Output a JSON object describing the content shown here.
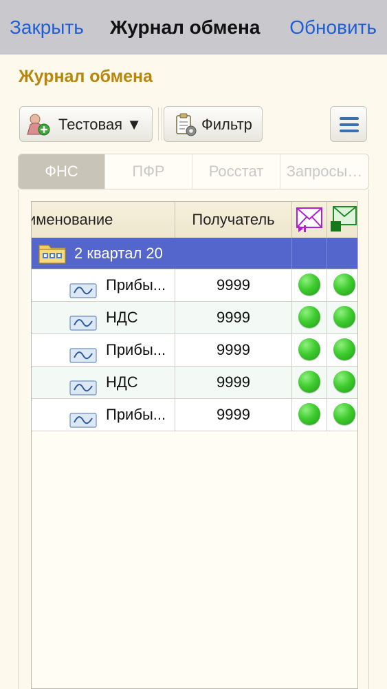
{
  "nav": {
    "close_label": "Закрыть",
    "title": "Журнал обмена",
    "refresh_label": "Обновить"
  },
  "form": {
    "title": "Журнал обмена"
  },
  "toolbar": {
    "mode_label": "Тестовая ▼",
    "filter_label": "Фильтр"
  },
  "tabs": [
    {
      "label": "ФНС",
      "active": true
    },
    {
      "label": "ПФР",
      "active": false
    },
    {
      "label": "Росстат",
      "active": false
    },
    {
      "label": "Запросы…",
      "active": false
    }
  ],
  "table": {
    "columns": {
      "name": "именование",
      "recipient": "Получатель"
    },
    "group": {
      "label": "2 квартал 20"
    },
    "rows": [
      {
        "name": "Прибы...",
        "recipient": "9999",
        "status1": "green",
        "status2": "green"
      },
      {
        "name": "НДС",
        "recipient": "9999",
        "status1": "green",
        "status2": "green"
      },
      {
        "name": "Прибы...",
        "recipient": "9999",
        "status1": "green",
        "status2": "green"
      },
      {
        "name": "НДС",
        "recipient": "9999",
        "status1": "green",
        "status2": "green"
      },
      {
        "name": "Прибы...",
        "recipient": "9999",
        "status1": "green",
        "status2": "green"
      }
    ]
  },
  "colors": {
    "accent": "#1f5fd6",
    "title": "#b8860b",
    "group_row": "#5466cb",
    "status_ok": "#3fcc2f"
  },
  "icons": {
    "mode_button": "users-add-icon",
    "filter_button": "clipboard-gear-icon",
    "menu_button": "hamburger-menu-icon",
    "column_sent": "envelope-outgoing-icon",
    "column_received": "envelope-received-icon",
    "group_row": "folder-icon",
    "document_row": "document-wave-icon"
  }
}
